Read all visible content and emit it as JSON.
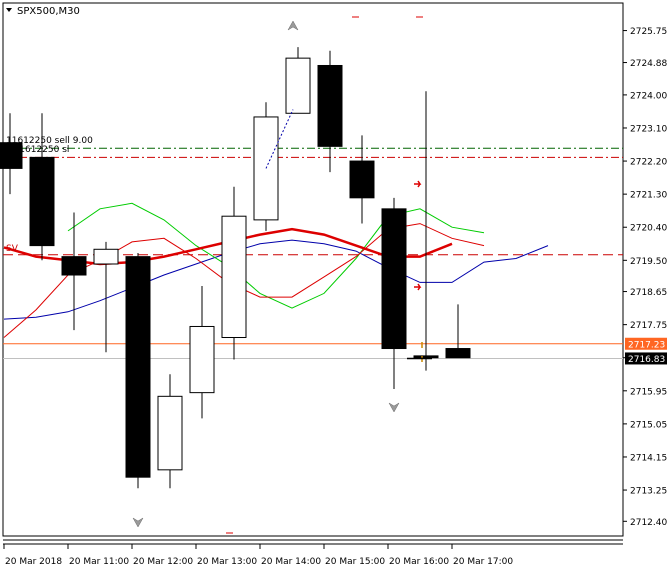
{
  "window": {
    "symbol_label": "SPX500,M30"
  },
  "chart_data": {
    "type": "candlestick",
    "symbol": "SPX500",
    "timeframe": "M30",
    "ylim": [
      2712.0,
      2726.5
    ],
    "y_ticks": [
      "2725.75",
      "2724.88",
      "2724.00",
      "2723.10",
      "2722.20",
      "2721.30",
      "2720.40",
      "2719.50",
      "2718.65",
      "2717.75",
      "2716.85",
      "2715.95",
      "2715.05",
      "2714.15",
      "2713.25",
      "2712.40"
    ],
    "x_tick_labels": [
      "20 Mar 2018",
      "20 Mar 11:00",
      "20 Mar 12:00",
      "20 Mar 13:00",
      "20 Mar 14:00",
      "20 Mar 15:00",
      "20 Mar 16:00",
      "20 Mar 17:00"
    ],
    "x_tick_bars": [
      0,
      2,
      4,
      6,
      8,
      10,
      12,
      14
    ],
    "candles": [
      {
        "open": 2722.7,
        "high": 2723.5,
        "low": 2721.3,
        "close": 2722.0
      },
      {
        "open": 2722.3,
        "high": 2723.5,
        "low": 2719.5,
        "close": 2719.9
      },
      {
        "open": 2719.6,
        "high": 2720.8,
        "low": 2717.6,
        "close": 2719.1
      },
      {
        "open": 2719.4,
        "high": 2720.0,
        "low": 2717.0,
        "close": 2719.8
      },
      {
        "open": 2719.6,
        "high": 2719.7,
        "low": 2713.3,
        "close": 2713.6
      },
      {
        "open": 2713.8,
        "high": 2716.4,
        "low": 2713.3,
        "close": 2715.8
      },
      {
        "open": 2715.9,
        "high": 2718.8,
        "low": 2715.2,
        "close": 2717.7
      },
      {
        "open": 2717.4,
        "high": 2721.5,
        "low": 2716.8,
        "close": 2720.7
      },
      {
        "open": 2720.6,
        "high": 2723.8,
        "low": 2720.3,
        "close": 2723.4
      },
      {
        "open": 2723.5,
        "high": 2725.3,
        "low": 2723.5,
        "close": 2725.0
      },
      {
        "open": 2724.8,
        "high": 2725.2,
        "low": 2721.9,
        "close": 2722.6
      },
      {
        "open": 2722.2,
        "high": 2722.9,
        "low": 2720.5,
        "close": 2721.2
      },
      {
        "open": 2720.9,
        "high": 2721.2,
        "low": 2716.0,
        "close": 2717.1
      },
      {
        "open": 2716.9,
        "high": 2724.1,
        "low": 2716.5,
        "close": 2716.85
      },
      {
        "open": 2717.1,
        "high": 2718.3,
        "low": 2716.9,
        "close": 2716.85
      }
    ],
    "series": [
      {
        "color": "#0000aa",
        "values": [
          2717.9,
          2717.95,
          2718.1,
          2718.4,
          2718.75,
          2719.1,
          2719.4,
          2719.7,
          2719.95,
          2720.05,
          2719.95,
          2719.75,
          2719.3,
          2718.9,
          2718.9,
          2719.45,
          2719.55,
          2719.9
        ]
      },
      {
        "color": "#00cc00",
        "values": [
          null,
          null,
          2720.3,
          2720.9,
          2721.05,
          2720.6,
          2719.9,
          2719.35,
          2718.6,
          2718.2,
          2718.6,
          2719.55,
          2720.7,
          2720.9,
          2720.4,
          2720.25
        ]
      },
      {
        "color": "#dd0000",
        "values": [
          2717.4,
          2718.15,
          2719.1,
          2719.5,
          2720.0,
          2720.1,
          2719.55,
          2718.9,
          2718.5,
          2718.5,
          2719.05,
          2719.6,
          2720.35,
          2720.5,
          2720.1,
          2719.9
        ]
      },
      {
        "color": "#dd0000",
        "bold": true,
        "values": [
          2719.85,
          2719.6,
          2719.5,
          2719.4,
          2719.45,
          2719.6,
          2719.8,
          2720.0,
          2720.2,
          2720.35,
          2720.2,
          2719.9,
          2719.6,
          2719.6,
          2719.95
        ]
      }
    ],
    "horizontal_lines": [
      {
        "price": 2722.55,
        "color": "#006400",
        "style": "dash-dot"
      },
      {
        "price": 2722.3,
        "color": "#cc0000",
        "style": "dash-dot"
      },
      {
        "price": 2719.65,
        "color": "#cc0000",
        "style": "dashed"
      },
      {
        "price": 2717.23,
        "color": "#ff6622",
        "style": "solid"
      },
      {
        "price": 2716.83,
        "color": "#c0c0c0",
        "style": "solid"
      }
    ],
    "order_labels": {
      "sell_label": "11612250 sell 9.00",
      "sl_label": "#11612250 sl",
      "sv_label": "SV"
    },
    "price_boxes": [
      {
        "price": 2717.23,
        "label": "2717.23",
        "bg": "#ff6622"
      },
      {
        "price": 2716.83,
        "label": "2716.83",
        "bg": "#000000"
      }
    ]
  }
}
